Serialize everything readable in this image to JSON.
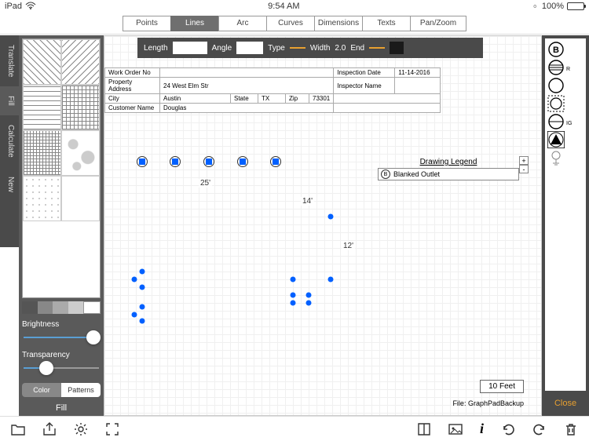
{
  "status": {
    "device": "iPad",
    "time": "9:54 AM",
    "battery": "100%"
  },
  "toolbar": {
    "items": [
      "Points",
      "Lines",
      "Arc",
      "Curves",
      "Dimensions",
      "Texts",
      "Pan/Zoom"
    ],
    "active": "Lines"
  },
  "props": {
    "length_label": "Length",
    "length": "",
    "angle_label": "Angle",
    "angle": "",
    "type_label": "Type",
    "width_label": "Width",
    "width": "2.0",
    "end_label": "End"
  },
  "left_tabs": [
    "Translate",
    "Fill",
    "Calculate",
    "New"
  ],
  "left_active": "Fill",
  "sliders": {
    "brightness_label": "Brightness",
    "brightness": 100,
    "transparency_label": "Transparency",
    "transparency": 30
  },
  "toggle": {
    "left": "Color",
    "right": "Patterns",
    "active": "Patterns"
  },
  "fill_label": "Fill",
  "form": {
    "work_order_label": "Work Order No",
    "work_order": "",
    "address_label": "Property Address",
    "address": "24 West Elm Str",
    "city_label": "City",
    "city": "Austin",
    "state_label": "State",
    "state": "TX",
    "zip_label": "Zip",
    "zip": "73301",
    "customer_label": "Customer Name",
    "customer": "Douglas",
    "insp_date_label": "Inspection Date",
    "insp_date": "11-14-2016",
    "inspector_label": "Inspector Name",
    "inspector": ""
  },
  "dimensions": {
    "d1": "25'",
    "d2": "14'",
    "d3": "12'"
  },
  "legend": {
    "title": "Drawing Legend",
    "item1": "Blanked Outlet",
    "plus": "+",
    "minus": "-"
  },
  "scale": "10 Feet",
  "file_label": "File: ",
  "file_name": "GraphPadBackup",
  "right": {
    "close": "Close",
    "symbols": [
      "B",
      "R",
      "",
      "",
      "IG",
      "▲",
      "⏚"
    ]
  },
  "grays": [
    "#555555",
    "#888888",
    "#aaaaaa",
    "#cccccc",
    "#ffffff"
  ]
}
